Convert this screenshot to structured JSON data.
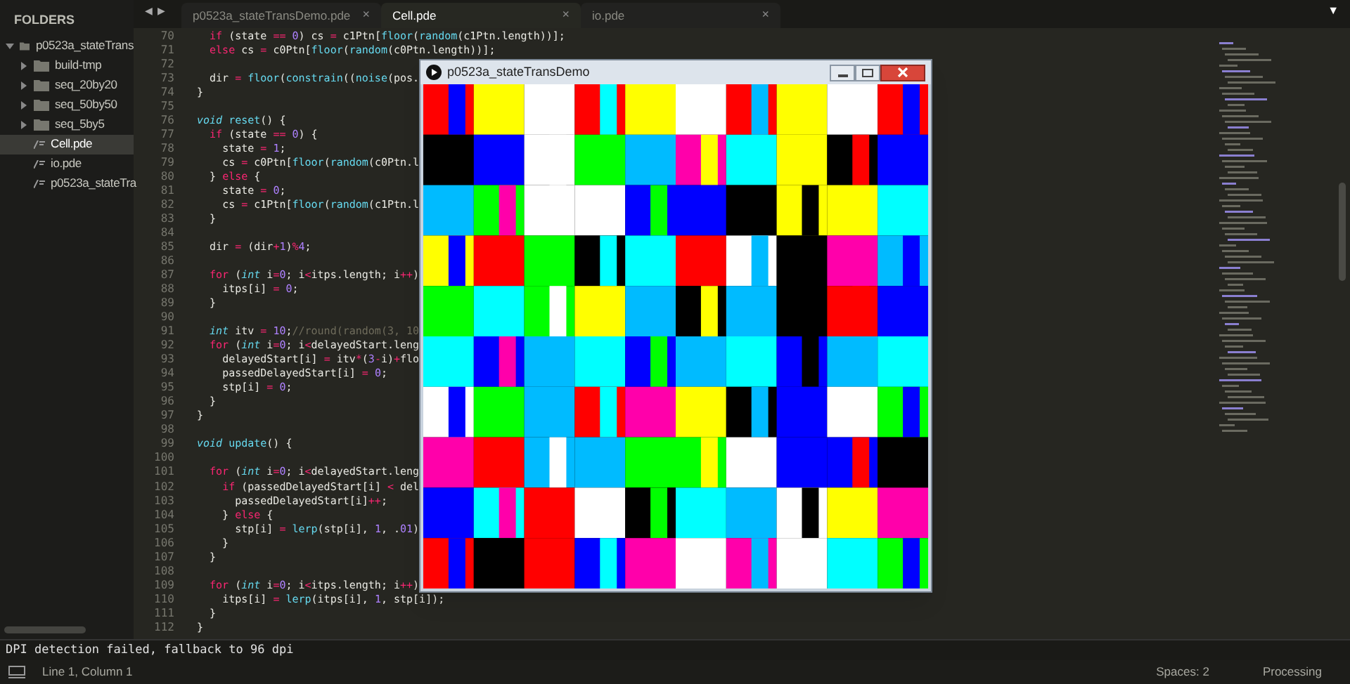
{
  "sidebar": {
    "title": "FOLDERS",
    "tree": [
      {
        "label": "p0523a_stateTrans",
        "kind": "folder",
        "expanded": true,
        "selected": false,
        "children": [
          {
            "label": "build-tmp",
            "kind": "folder",
            "expanded": false,
            "selected": false
          },
          {
            "label": "seq_20by20",
            "kind": "folder",
            "expanded": false,
            "selected": false
          },
          {
            "label": "seq_50by50",
            "kind": "folder",
            "expanded": false,
            "selected": false
          },
          {
            "label": "seq_5by5",
            "kind": "folder",
            "expanded": false,
            "selected": false
          },
          {
            "label": "Cell.pde",
            "kind": "file",
            "selected": true
          },
          {
            "label": "io.pde",
            "kind": "file",
            "selected": false
          },
          {
            "label": "p0523a_stateTra",
            "kind": "file",
            "selected": false
          }
        ]
      }
    ]
  },
  "nav": {
    "back": "◀",
    "forward": "▶"
  },
  "tabs": [
    {
      "label": "p0523a_stateTransDemo.pde",
      "close": "×",
      "selected": false
    },
    {
      "label": "Cell.pde",
      "close": "×",
      "selected": true
    },
    {
      "label": "io.pde",
      "close": "×",
      "selected": false
    }
  ],
  "tab_menu": "▼",
  "code": [
    {
      "n": "70",
      "text": "  if (state == 0) cs = c1Ptn[floor(random(c1Ptn.length))];"
    },
    {
      "n": "71",
      "text": "  else cs = c0Ptn[floor(random(c0Ptn.length))];"
    },
    {
      "n": "72"
    },
    {
      "n": "73",
      "text": "  dir = floor(constrain((noise(pos."
    },
    {
      "n": "74",
      "text": "}"
    },
    {
      "n": "75"
    },
    {
      "n": "76",
      "text": "void reset() {"
    },
    {
      "n": "77",
      "text": "  if (state == 0) {"
    },
    {
      "n": "78",
      "text": "    state = 1;"
    },
    {
      "n": "79",
      "text": "    cs = c0Ptn[floor(random(c0Ptn.l"
    },
    {
      "n": "80",
      "text": "  } else {"
    },
    {
      "n": "81",
      "text": "    state = 0;"
    },
    {
      "n": "82",
      "text": "    cs = c1Ptn[floor(random(c1Ptn.l"
    },
    {
      "n": "83",
      "text": "  }"
    },
    {
      "n": "84"
    },
    {
      "n": "85",
      "text": "  dir = (dir+1)%4;"
    },
    {
      "n": "86"
    },
    {
      "n": "87",
      "text": "  for (int i=0; i<itps.length; i++)"
    },
    {
      "n": "88",
      "text": "    itps[i] = 0;"
    },
    {
      "n": "89",
      "text": "  }"
    },
    {
      "n": "90"
    },
    {
      "n": "91",
      "text": "  int itv = 10;//round(random(3, 10"
    },
    {
      "n": "92",
      "text": "  for (int i=0; i<delayedStart.leng"
    },
    {
      "n": "93",
      "text": "    delayedStart[i] = itv*(3-i)+flo"
    },
    {
      "n": "94",
      "text": "    passedDelayedStart[i] = 0;"
    },
    {
      "n": "95",
      "text": "    stp[i] = 0;"
    },
    {
      "n": "96",
      "text": "  }"
    },
    {
      "n": "97",
      "text": "}"
    },
    {
      "n": "98"
    },
    {
      "n": "99",
      "text": "void update() {"
    },
    {
      "n": "100"
    },
    {
      "n": "101",
      "text": "  for (int i=0; i<delayedStart.leng"
    },
    {
      "n": "102",
      "text": "    if (passedDelayedStart[i] < del"
    },
    {
      "n": "103",
      "text": "      passedDelayedStart[i]++;"
    },
    {
      "n": "104",
      "text": "    } else {"
    },
    {
      "n": "105",
      "text": "      stp[i] = lerp(stp[i], 1, .01)"
    },
    {
      "n": "106",
      "text": "    }"
    },
    {
      "n": "107",
      "text": "  }"
    },
    {
      "n": "108"
    },
    {
      "n": "109",
      "text": "  for (int i=0; i<itps.length; i++)"
    },
    {
      "n": "110",
      "text": "    itps[i] = lerp(itps[i], 1, stp[i]);"
    },
    {
      "n": "111",
      "text": "  }"
    },
    {
      "n": "112",
      "text": "}"
    }
  ],
  "sketch_window": {
    "title": "p0523a_stateTransDemo"
  },
  "console": "DPI detection failed, fallback to 96 dpi",
  "status_bar": {
    "position": "Line 1, Column 1",
    "indent": "Spaces: 2",
    "syntax": "Processing"
  }
}
